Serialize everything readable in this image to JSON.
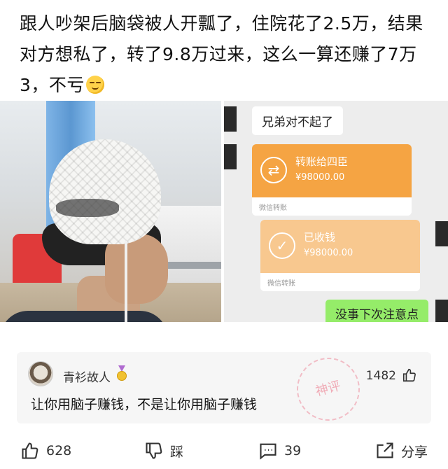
{
  "post": {
    "text": "跟人吵架后脑袋被人开瓢了，住院花了2.5万，结果对方想私了，转了9.8万过来，这么一算还赚了7万3，不亏"
  },
  "chat": {
    "message_in": "兄弟对不起了",
    "transfer": {
      "title": "转账给四臣",
      "amount": "¥98000.00",
      "footer": "微信转账"
    },
    "received": {
      "title": "已收钱",
      "amount": "¥98000.00",
      "footer": "微信转账"
    },
    "message_out": "没事下次注意点"
  },
  "comment": {
    "author": "青衫故人",
    "likes": "1482",
    "text": "让你用脑子赚钱，不是让你用脑子赚钱",
    "stamp": "神评"
  },
  "actions": {
    "like_count": "628",
    "dislike_label": "踩",
    "comment_count": "39",
    "share_label": "分享"
  },
  "colors": {
    "transfer_orange": "#f5a443",
    "received_orange": "#f8c88f",
    "chat_green": "#95ec69"
  }
}
